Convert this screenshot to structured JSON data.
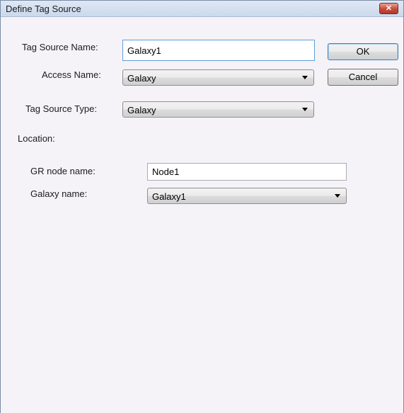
{
  "window": {
    "title": "Define Tag Source",
    "close_glyph": "✕"
  },
  "form": {
    "tag_source_name_label": "Tag Source Name:",
    "tag_source_name_value": "Galaxy1",
    "access_name_label": "Access Name:",
    "access_name_value": "Galaxy",
    "tag_source_type_label": "Tag Source Type:",
    "tag_source_type_value": "Galaxy",
    "location_label": "Location:"
  },
  "location": {
    "gr_node_label": "GR node name:",
    "gr_node_value": "Node1",
    "galaxy_name_label": "Galaxy name:",
    "galaxy_name_value": "Galaxy1"
  },
  "buttons": {
    "ok_label": "OK",
    "cancel_label": "Cancel"
  },
  "icons": {
    "close": "close-icon",
    "dropdown": "chevron-down-icon"
  }
}
